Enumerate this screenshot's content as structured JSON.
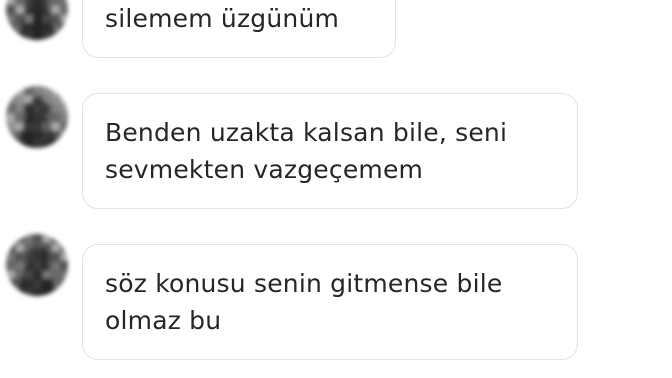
{
  "messages": [
    {
      "lines": [
        "silemem üzgünüm"
      ]
    },
    {
      "lines": [
        "Benden uzakta kalsan bile, seni",
        "sevmekten vazgeçemem"
      ]
    },
    {
      "lines": [
        "söz konusu senin gitmense bile",
        "olmaz bu"
      ]
    }
  ]
}
